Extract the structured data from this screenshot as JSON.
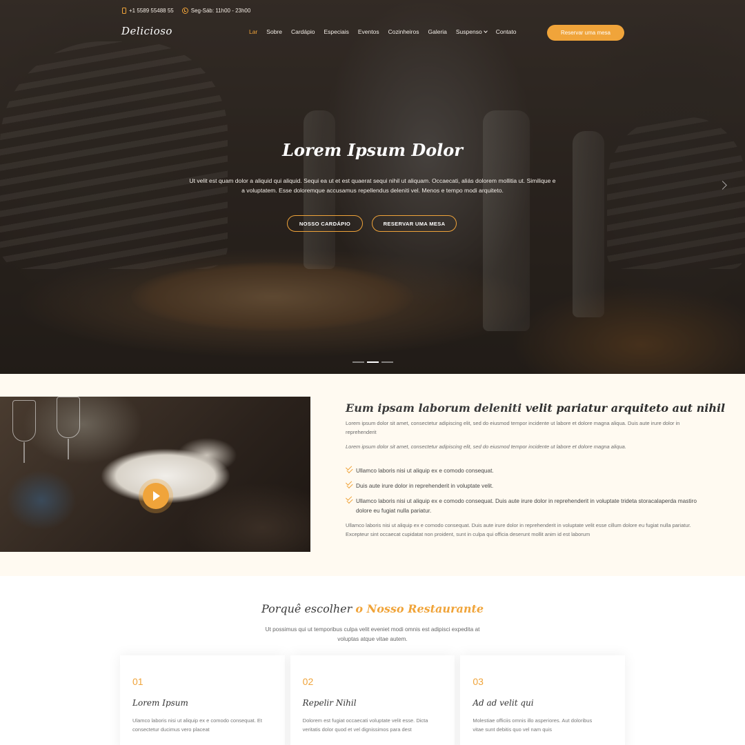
{
  "topbar": {
    "phone": "+1 5589 55488 55",
    "hours": "Seg-Sáb: 11h00 - 23h00"
  },
  "logo": "Delicioso",
  "nav": {
    "items": [
      "Lar",
      "Sobre",
      "Cardápio",
      "Especiais",
      "Eventos",
      "Cozinheiros",
      "Galeria",
      "Suspenso",
      "Contato"
    ],
    "active": "Lar",
    "cta": "Reservar uma mesa"
  },
  "hero": {
    "title": "Lorem Ipsum Dolor",
    "text": "Ut velit est quam dolor a aliquid qui aliquid. Sequi ea ut et est quaerat sequi nihil ut aliquam. Occaecati, aliás dolorem mollitia ut. Similique e a voluptatem. Esse doloremque accusamus repellendus deleniti vel. Menos e tempo modi arquiteto.",
    "btn_menu": "NOSSO CARDÁPIO",
    "btn_reserve": "RESERVAR UMA MESA"
  },
  "about": {
    "title_plain": "Eum ipsam laborum deleniti ",
    "title_bold": "velit pariatur arquiteto aut nihil",
    "p1": "Lorem ipsum dolor sit amet, consectetur adipiscing elit, sed do eiusmod tempor incidente ut labore et dolore magna aliqua. Duis aute irure dolor in reprehenderit",
    "p2": "Lorem ipsum dolor sit amet, consectetur adipiscing elit, sed do eiusmod tempor incidente ut labore et dolore magna aliqua.",
    "checks": [
      "Ullamco laboris nisi ut aliquip ex e comodo consequat.",
      "Duis aute irure dolor in reprehenderit in voluptate velit.",
      "Ullamco laboris nisi ut aliquip ex e comodo consequat. Duis aute irure dolor in reprehenderit in voluptate trideta storacalaperda mastiro dolore eu fugiat nulla pariatur."
    ],
    "p3": "Ullamco laboris nisi ut aliquip ex e comodo consequat. Duis aute irure dolor in reprehenderit in voluptate velit esse cillum dolore eu fugiat nulla pariatur. Excepteur sint occaecat cupidatat non proident, sunt in culpa qui officia deserunt mollit anim id est laborum"
  },
  "why": {
    "title_plain": "Porquê escolher ",
    "title_accent": "o Nosso Restaurante",
    "text": "Ut possimus qui ut temporibus culpa velit eveniet modi omnis est adipisci expedita at voluptas atque vitae autem.",
    "cards": [
      {
        "num": "01",
        "title": "Lorem Ipsum",
        "text": "Ulamco laboris nisi ut aliquip ex e comodo consequat. Et consectetur ducimus vero placeat"
      },
      {
        "num": "02",
        "title": "Repelir Nihil",
        "text": "Dolorem est fugiat occaecati voluptate velit esse. Dicta veritatis dolor quod et vel dignissimos para dest"
      },
      {
        "num": "03",
        "title": "Ad ad velit qui",
        "text": "Molestiae officiis omnis illo asperiores. Aut doloribus vitae sunt debitis quo vel nam quis"
      }
    ]
  },
  "colors": {
    "accent": "#f0a43a",
    "about_bg": "#fffaf1"
  }
}
